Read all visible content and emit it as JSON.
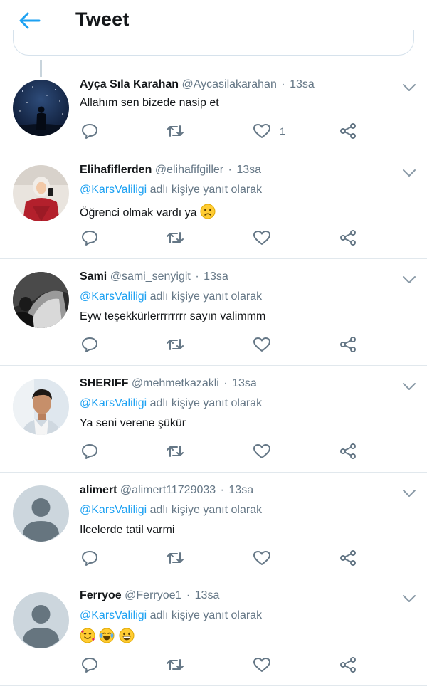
{
  "header": {
    "title": "Tweet",
    "back_icon": "arrow-left-icon",
    "accent": "#1da1f2"
  },
  "reply_to_label": "adlı kişiye yanıt olarak",
  "tweets": [
    {
      "name": "Ayça Sıla Karahan",
      "handle": "@Aycasilakarahan",
      "time": "13sa",
      "reply_mention": "",
      "text": "Allahım sen bizede nasip et",
      "likes": "1",
      "avatar": "night-sky-avatar"
    },
    {
      "name": "Elihafiflerden",
      "handle": "@elihafifgiller",
      "time": "13sa",
      "reply_mention": "@KarsValiligi",
      "text": "Öğrenci olmak vardı ya",
      "emoji": [
        "slightly-frowning-face-icon"
      ],
      "likes": "",
      "avatar": "woman-red-jacket-avatar"
    },
    {
      "name": "Sami",
      "handle": "@sami_senyigit",
      "time": "13sa",
      "reply_mention": "@KarsValiligi",
      "text": "Eyw teşekkürlerrrrrrrr sayın valimmm",
      "likes": "",
      "avatar": "dark-photo-avatar"
    },
    {
      "name": "SHERIFF",
      "handle": "@mehmetkazakli",
      "time": "13sa",
      "reply_mention": "@KarsValiligi",
      "text": "Ya seni verene şükür",
      "likes": "",
      "avatar": "man-portrait-avatar"
    },
    {
      "name": "alimert",
      "handle": "@alimert11729033",
      "time": "13sa",
      "reply_mention": "@KarsValiligi",
      "text": "Ilcelerde tatil varmi",
      "likes": "",
      "avatar": "default-user-avatar"
    },
    {
      "name": "Ferryoe",
      "handle": "@Ferryoe1",
      "time": "13sa",
      "reply_mention": "@KarsValiligi",
      "text": "",
      "emoji": [
        "smiling-face-with-hearts-icon",
        "face-with-tears-of-joy-icon",
        "grinning-face-icon"
      ],
      "likes": "",
      "avatar": "default-user-avatar"
    }
  ],
  "colors": {
    "text": "#14171a",
    "muted": "#657786",
    "link": "#1da1f2",
    "border": "#e1e8ed"
  }
}
